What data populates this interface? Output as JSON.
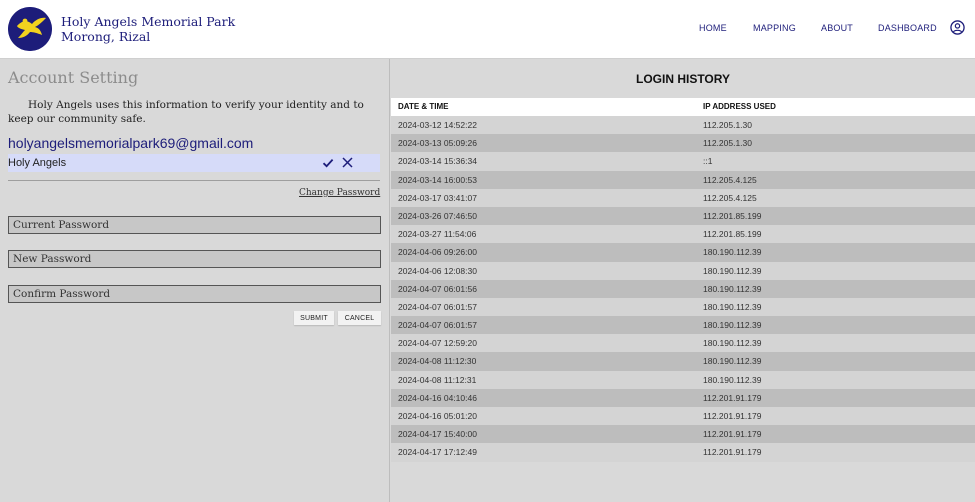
{
  "header": {
    "brand_line1": "Holy Angels Memorial Park",
    "brand_line2": "Morong, Rizal",
    "nav": [
      "HOME",
      "MAPPING",
      "ABOUT",
      "DASHBOARD"
    ]
  },
  "account": {
    "title": "Account Setting",
    "description": "Holy Angels uses this information to verify your identity and to keep our community safe.",
    "email": "holyangelsmemorialpark69@gmail.com",
    "name_value": "Holy Angels",
    "change_password": "Change Password",
    "current_password_placeholder": "Current Password",
    "new_password_placeholder": "New Password",
    "confirm_password_placeholder": "Confirm Password",
    "submit": "SUBMIT",
    "cancel": "CANCEL"
  },
  "login_history": {
    "title": "LOGIN HISTORY",
    "col_date": "DATE & TIME",
    "col_ip": "IP ADDRESS USED",
    "rows": [
      {
        "date": "2024-03-12 14:52:22",
        "ip": "112.205.1.30"
      },
      {
        "date": "2024-03-13 05:09:26",
        "ip": "112.205.1.30"
      },
      {
        "date": "2024-03-14 15:36:34",
        "ip": "::1"
      },
      {
        "date": "2024-03-14 16:00:53",
        "ip": "112.205.4.125"
      },
      {
        "date": "2024-03-17 03:41:07",
        "ip": "112.205.4.125"
      },
      {
        "date": "2024-03-26 07:46:50",
        "ip": "112.201.85.199"
      },
      {
        "date": "2024-03-27 11:54:06",
        "ip": "112.201.85.199"
      },
      {
        "date": "2024-04-06 09:26:00",
        "ip": "180.190.112.39"
      },
      {
        "date": "2024-04-06 12:08:30",
        "ip": "180.190.112.39"
      },
      {
        "date": "2024-04-07 06:01:56",
        "ip": "180.190.112.39"
      },
      {
        "date": "2024-04-07 06:01:57",
        "ip": "180.190.112.39"
      },
      {
        "date": "2024-04-07 06:01:57",
        "ip": "180.190.112.39"
      },
      {
        "date": "2024-04-07 12:59:20",
        "ip": "180.190.112.39"
      },
      {
        "date": "2024-04-08 11:12:30",
        "ip": "180.190.112.39"
      },
      {
        "date": "2024-04-08 11:12:31",
        "ip": "180.190.112.39"
      },
      {
        "date": "2024-04-16 04:10:46",
        "ip": "112.201.91.179"
      },
      {
        "date": "2024-04-16 05:01:20",
        "ip": "112.201.91.179"
      },
      {
        "date": "2024-04-17 15:40:00",
        "ip": "112.201.91.179"
      },
      {
        "date": "2024-04-17 17:12:49",
        "ip": "112.201.91.179"
      }
    ]
  },
  "icons": {
    "logo": "angel-logo",
    "user": "user-circle-icon",
    "confirm": "check-icon",
    "cancel": "close-icon"
  },
  "colors": {
    "brand": "#1d1d7a",
    "logo_gold": "#f2d21e",
    "highlight": "#d6dbf9"
  }
}
